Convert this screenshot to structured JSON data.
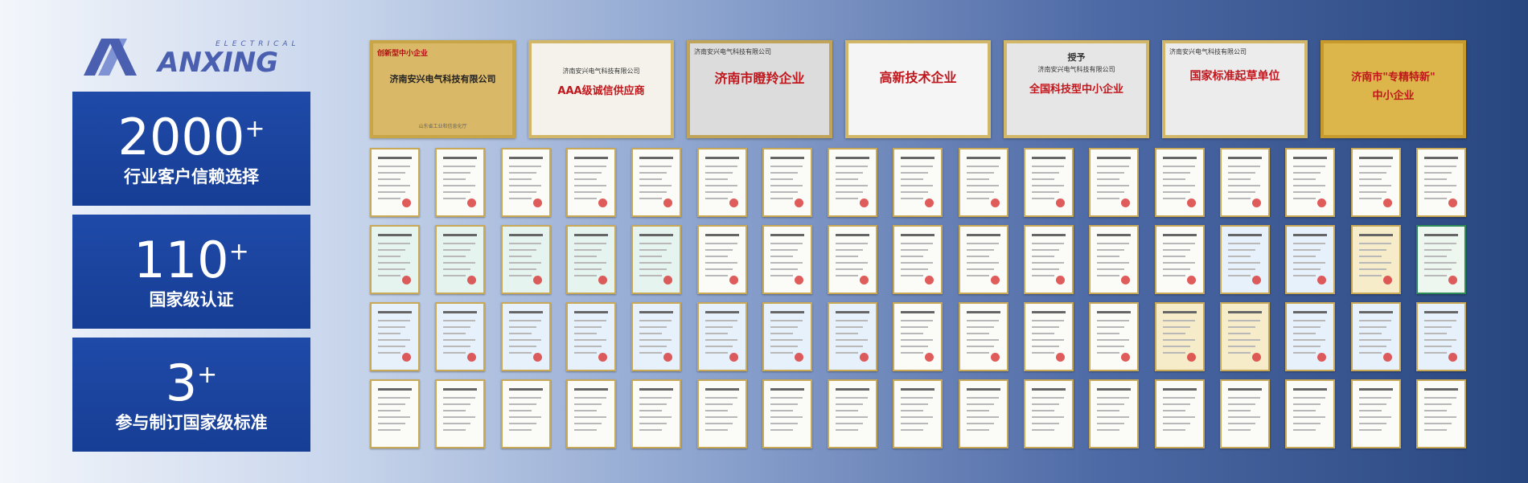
{
  "brand": {
    "name": "ANXING",
    "sub": "ELECTRICAL",
    "color": "#4a5fb0"
  },
  "stats": [
    {
      "number": "2000",
      "suffix": "+",
      "label": "行业客户信赖选择"
    },
    {
      "number": "110",
      "suffix": "+",
      "label": "国家级认证"
    },
    {
      "number": "3",
      "suffix": "+",
      "label": "参与制订国家级标准"
    }
  ],
  "plaques": [
    {
      "top": "创新型中小企业",
      "main": "济南安兴电气科技有限公司",
      "bottom": "",
      "footer": "山东省工业和信息化厅"
    },
    {
      "top": "济南安兴电气科技有限公司",
      "main": "AAA级诚信供应商",
      "bottom": "",
      "footer": ""
    },
    {
      "top": "济南安兴电气科技有限公司",
      "main": "济南市瞪羚企业",
      "bottom": "",
      "footer": ""
    },
    {
      "top": "",
      "main": "高新技术企业",
      "bottom": "",
      "footer": ""
    },
    {
      "top": "授予",
      "main": "全国科技型中小企业",
      "bottom": "济南安兴电气科技有限公司",
      "footer": ""
    },
    {
      "top": "济南安兴电气科技有限公司",
      "main": "国家标准起草单位",
      "bottom": "",
      "footer": ""
    },
    {
      "top": "",
      "main": "济南市\"专精特新\"",
      "bottom": "中小企业",
      "footer": ""
    }
  ],
  "certificate_grid": {
    "rows": 4,
    "per_row": 17
  },
  "colors": {
    "stat_panel": "#1f4aa8",
    "frame_gold": "#c9a956"
  }
}
